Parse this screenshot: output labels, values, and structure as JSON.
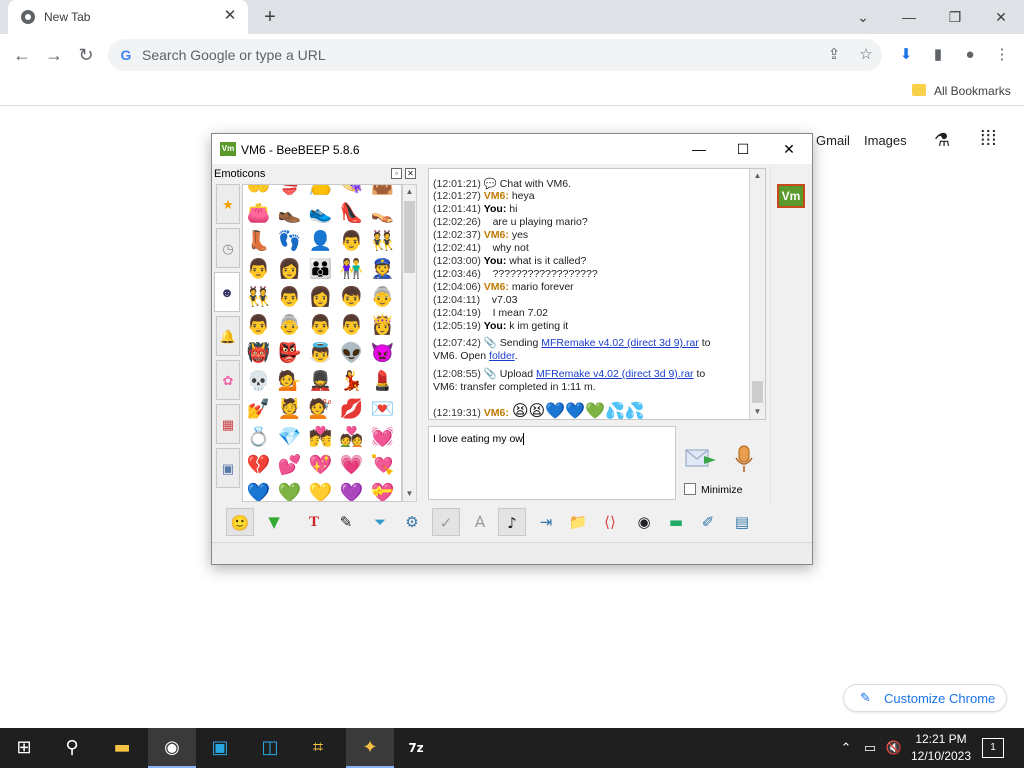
{
  "browser": {
    "tab_title": "New Tab",
    "omnibox_placeholder": "Search Google or type a URL",
    "bookmarks_label": "All Bookmarks",
    "ntp_links": [
      "Gmail",
      "Images"
    ],
    "customize_label": "Customize Chrome"
  },
  "beebeep": {
    "title": "VM6 - BeeBEEP 5.8.6",
    "emoticons_header": "Emoticons",
    "avatar_label": "Vm",
    "chat": [
      {
        "ts": "(12:01:21)",
        "who": "",
        "text": "Chat with VM6."
      },
      {
        "ts": "(12:01:27)",
        "who": "VM6:",
        "text": "heya"
      },
      {
        "ts": "(12:01:41)",
        "who": "You:",
        "text": "hi"
      },
      {
        "ts": "(12:02:26)",
        "who": "",
        "text": "are u playing mario?"
      },
      {
        "ts": "(12:02:37)",
        "who": "VM6:",
        "text": "yes"
      },
      {
        "ts": "(12:02:41)",
        "who": "",
        "text": "why not"
      },
      {
        "ts": "(12:03:00)",
        "who": "You:",
        "text": "what is it called?"
      },
      {
        "ts": "(12:03:46)",
        "who": "",
        "text": "??????????????????"
      },
      {
        "ts": "(12:04:06)",
        "who": "VM6:",
        "text": "mario forever"
      },
      {
        "ts": "(12:04:11)",
        "who": "",
        "text": "v7.03"
      },
      {
        "ts": "(12:04:19)",
        "who": "",
        "text": "I mean 7.02"
      },
      {
        "ts": "(12:05:19)",
        "who": "You:",
        "text": "k im geting it"
      }
    ],
    "transfer1": {
      "ts": "(12:07:42)",
      "prefix": "Sending",
      "file": "MFRemake v4.02 (direct 3d 9).rar",
      "suffix": "to",
      "line2": "VM6. Open",
      "link2": "folder",
      "end": "."
    },
    "transfer2": {
      "ts": "(12:08:55)",
      "prefix": "Upload",
      "file": "MFRemake v4.02 (direct 3d 9).rar",
      "suffix": "to",
      "line2": "VM6: transfer completed in 1:11 m."
    },
    "last_line": {
      "ts": "(12:19:31)",
      "who": "VM6:",
      "emojis": "😫😫💙💙💚💦💦"
    },
    "input_text": "I love eating my ow",
    "minimize_label": "Minimize",
    "emoji_rows": [
      [
        "🤲",
        "👙",
        "👝",
        "👒",
        "👜"
      ],
      [
        "👛",
        "👞",
        "👟",
        "👠",
        "👡"
      ],
      [
        "👢",
        "👣",
        "👤",
        "👨",
        "👯"
      ],
      [
        "👨",
        "👩",
        "👪",
        "👫",
        "👮"
      ],
      [
        "👯",
        "👨",
        "👩",
        "👦",
        "👵"
      ],
      [
        "👨",
        "👵",
        "👨",
        "👨",
        "👸"
      ],
      [
        "👹",
        "👺",
        "👼",
        "👽",
        "👿"
      ],
      [
        "💀",
        "💁",
        "💂",
        "💃",
        "💄"
      ],
      [
        "💅",
        "💆",
        "💇",
        "💋",
        "💌"
      ],
      [
        "💍",
        "💎",
        "💏",
        "💑",
        "💓"
      ],
      [
        "💔",
        "💕",
        "💖",
        "💗",
        "💘"
      ],
      [
        "💙",
        "💚",
        "💛",
        "💜",
        "💝"
      ]
    ]
  },
  "taskbar": {
    "time": "12:21 PM",
    "date": "12/10/2023",
    "net_label": "Network",
    "notif_count": "1"
  }
}
